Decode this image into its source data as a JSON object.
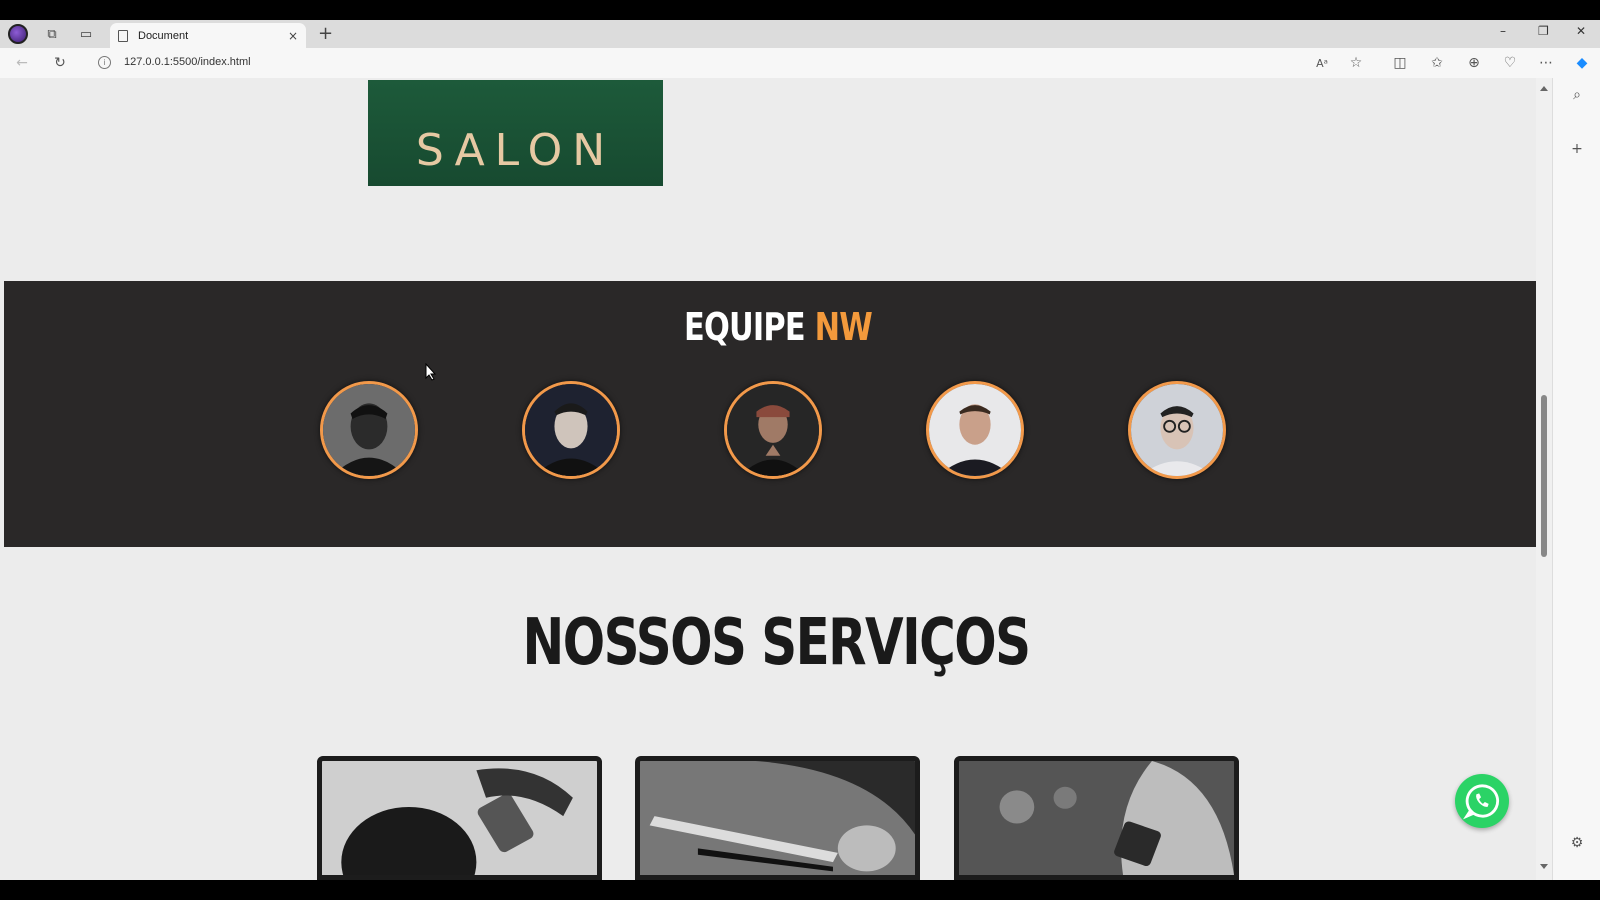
{
  "browser": {
    "tab_title": "Document",
    "address": "127.0.0.1:5500/index.html",
    "new_tab": "+",
    "close_tab": "×",
    "minimize": "–",
    "restore": "❐",
    "close_window": "✕"
  },
  "page": {
    "banner_text": "SALON",
    "team": {
      "title_main": "EQUIPE ",
      "title_accent": "NW",
      "accent_color": "#f39a3c",
      "members_count": 5
    },
    "services": {
      "title": "NOSSOS SERVIÇOS"
    }
  },
  "colors": {
    "team_bg": "#2a2828",
    "banner_green": "#1d5a3a",
    "whatsapp_green": "#2bd366",
    "avatar_ring": "#f2994a"
  }
}
